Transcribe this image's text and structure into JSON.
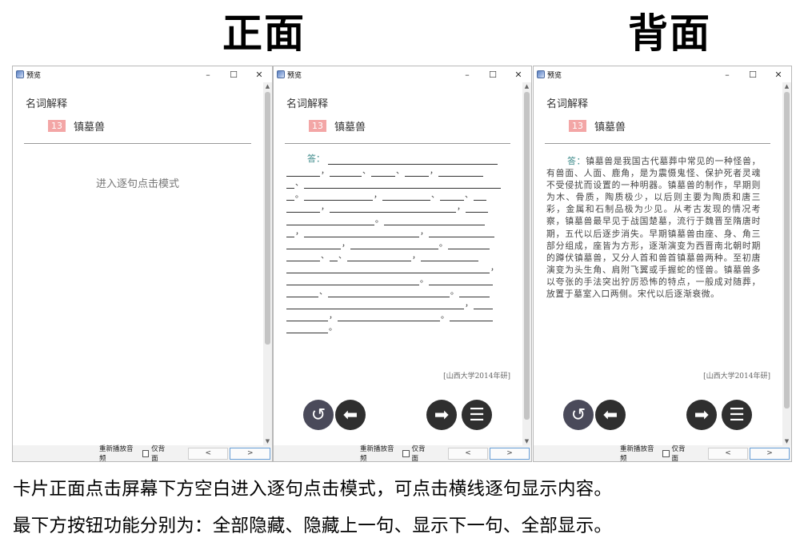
{
  "headings": {
    "front": "正面",
    "back": "背面"
  },
  "window": {
    "title": "预览",
    "minimize": "–",
    "maximize": "☐",
    "close": "✕"
  },
  "card": {
    "section": "名词解释",
    "number": "13",
    "term": "镇墓兽",
    "front_hint": "进入逐句点击模式",
    "answer_label": "答：",
    "answer": "镇墓兽是我国古代墓葬中常见的一种怪兽，有兽面、人面、鹿角，是为震慑鬼怪、保护死者灵魂不受侵扰而设置的一种明器。镇墓兽的制作，早期则为木、骨质，陶质极少，以后则主要为陶质和唐三彩，金属和石制品极为少见。从考古发现的情况考察，镇墓兽最早见于战国楚墓，流行于魏晋至隋唐时期，五代以后逐步消失。早期镇墓兽由座、身、角三部分组成，座皆为方形，逐渐演变为西晋南北朝时期的蹲伏镇墓兽，又分人首和兽首镇墓兽两种。至初唐演变为头生角、肩附飞翼或手握蛇的怪兽。镇墓兽多以夸张的手法突出狞厉恐怖的特点，一般成对随葬，放置于墓室入口两侧。宋代以后逐渐衰微。",
    "source": "[山西大学2014年研]"
  },
  "blank_rows": [
    [
      [
        "t",
        "答："
      ],
      [
        "l",
        212
      ]
    ],
    [
      [
        "l",
        42
      ],
      [
        "p",
        "，"
      ],
      [
        "l",
        40
      ],
      [
        "p",
        "、"
      ],
      [
        "l",
        30
      ],
      [
        "p",
        "、"
      ],
      [
        "l",
        30
      ],
      [
        "p",
        "，"
      ],
      [
        "l",
        56
      ]
    ],
    [
      [
        "l",
        10
      ],
      [
        "p",
        "、"
      ],
      [
        "l",
        246
      ]
    ],
    [
      [
        "l",
        10
      ],
      [
        "p",
        "。"
      ],
      [
        "l",
        86
      ],
      [
        "p",
        "，"
      ],
      [
        "l",
        60
      ],
      [
        "p",
        "、"
      ],
      [
        "l",
        30
      ],
      [
        "p",
        "、"
      ],
      [
        "l",
        16
      ]
    ],
    [
      [
        "l",
        42
      ],
      [
        "p",
        "，"
      ],
      [
        "l",
        158
      ],
      [
        "p",
        "，"
      ],
      [
        "l",
        28
      ]
    ],
    [
      [
        "l",
        110
      ],
      [
        "p",
        "。"
      ],
      [
        "l",
        126
      ]
    ],
    [
      [
        "l",
        10
      ],
      [
        "p",
        "，"
      ],
      [
        "l",
        144
      ],
      [
        "p",
        "，"
      ],
      [
        "l",
        82
      ]
    ],
    [
      [
        "l",
        68
      ],
      [
        "p",
        "，"
      ],
      [
        "l",
        110
      ],
      [
        "p",
        "。"
      ],
      [
        "l",
        52
      ]
    ],
    [
      [
        "l",
        42
      ],
      [
        "p",
        "、"
      ],
      [
        "l",
        10
      ],
      [
        "p",
        "、"
      ],
      [
        "l",
        80
      ],
      [
        "p",
        "，"
      ],
      [
        "l",
        72
      ]
    ],
    [
      [
        "l",
        254
      ],
      [
        "p",
        "，"
      ]
    ],
    [
      [
        "l",
        166
      ],
      [
        "p",
        "。"
      ],
      [
        "l",
        80
      ]
    ],
    [
      [
        "l",
        40
      ],
      [
        "p",
        "、"
      ],
      [
        "l",
        152
      ],
      [
        "p",
        "。"
      ],
      [
        "l",
        38
      ]
    ],
    [
      [
        "l",
        222
      ],
      [
        "p",
        "，"
      ],
      [
        "l",
        24
      ]
    ],
    [
      [
        "l",
        52
      ],
      [
        "p",
        "，"
      ],
      [
        "l",
        128
      ],
      [
        "p",
        "。"
      ],
      [
        "l",
        54
      ]
    ],
    [
      [
        "l",
        52
      ],
      [
        "p",
        "。"
      ]
    ]
  ],
  "nav_icons": {
    "hide_all": "undo-circle-icon",
    "hide_prev": "arrow-left-icon",
    "show_next": "arrow-right-icon",
    "show_all": "list-lines-icon"
  },
  "bottombar": {
    "replay": "重新播放音频",
    "back_only": "仅背面",
    "prev": "<",
    "next": ">"
  },
  "captions": [
    "卡片正面点击屏幕下方空白进入逐句点击模式，可点击横线逐句显示内容。",
    "最下方按钮功能分别为：全部隐藏、隐藏上一句、显示下一句、全部显示。"
  ]
}
